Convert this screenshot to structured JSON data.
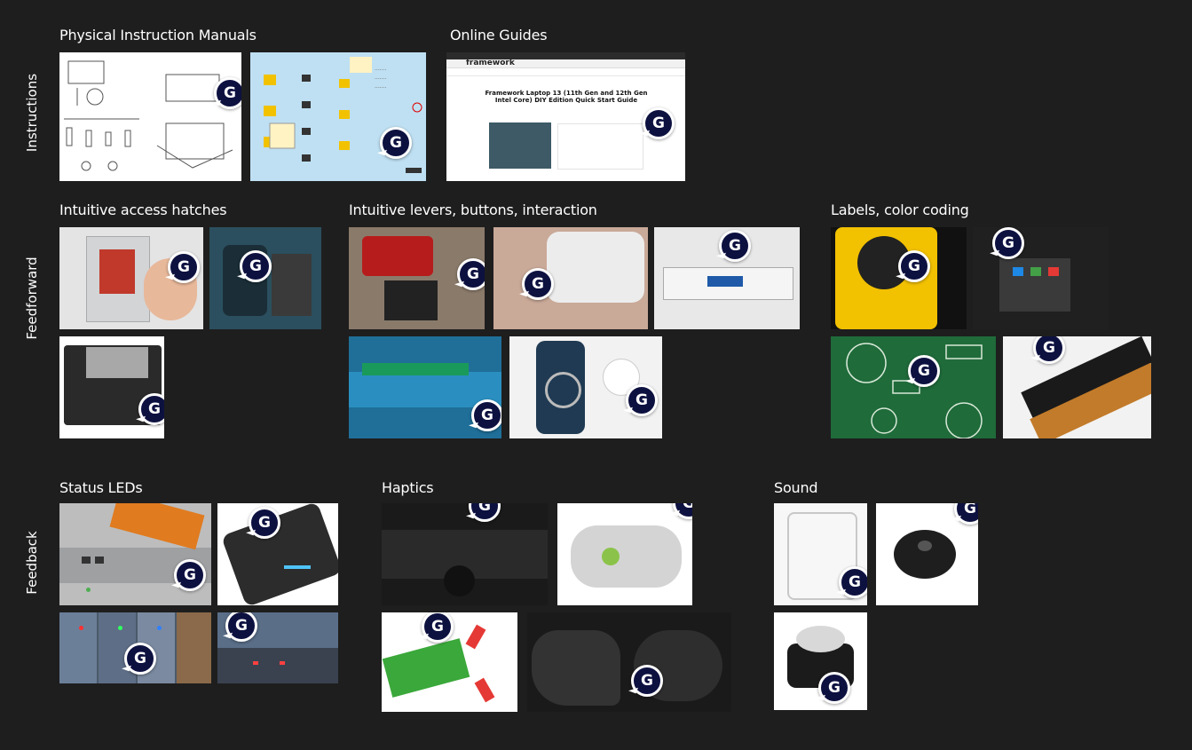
{
  "rows": {
    "instructions": "Instructions",
    "feedforward": "Feedforward",
    "feedback": "Feedback"
  },
  "sections": {
    "physical_manuals": "Physical Instruction Manuals",
    "online_guides": "Online Guides",
    "access_hatches": "Intuitive access hatches",
    "levers_buttons": "Intuitive levers, buttons, interaction",
    "labels_color": "Labels, color coding",
    "status_leds": "Status LEDs",
    "haptics": "Haptics",
    "sound": "Sound"
  },
  "online_guide": {
    "brand": "framework",
    "title": "Framework Laptop 13 (11th Gen and 12th Gen Intel Core) DIY Edition Quick Start Guide"
  },
  "badge_letter": "G",
  "colors": {
    "background": "#1e1e1e",
    "badge_fill": "#0d1140",
    "badge_border": "#ffffff"
  }
}
